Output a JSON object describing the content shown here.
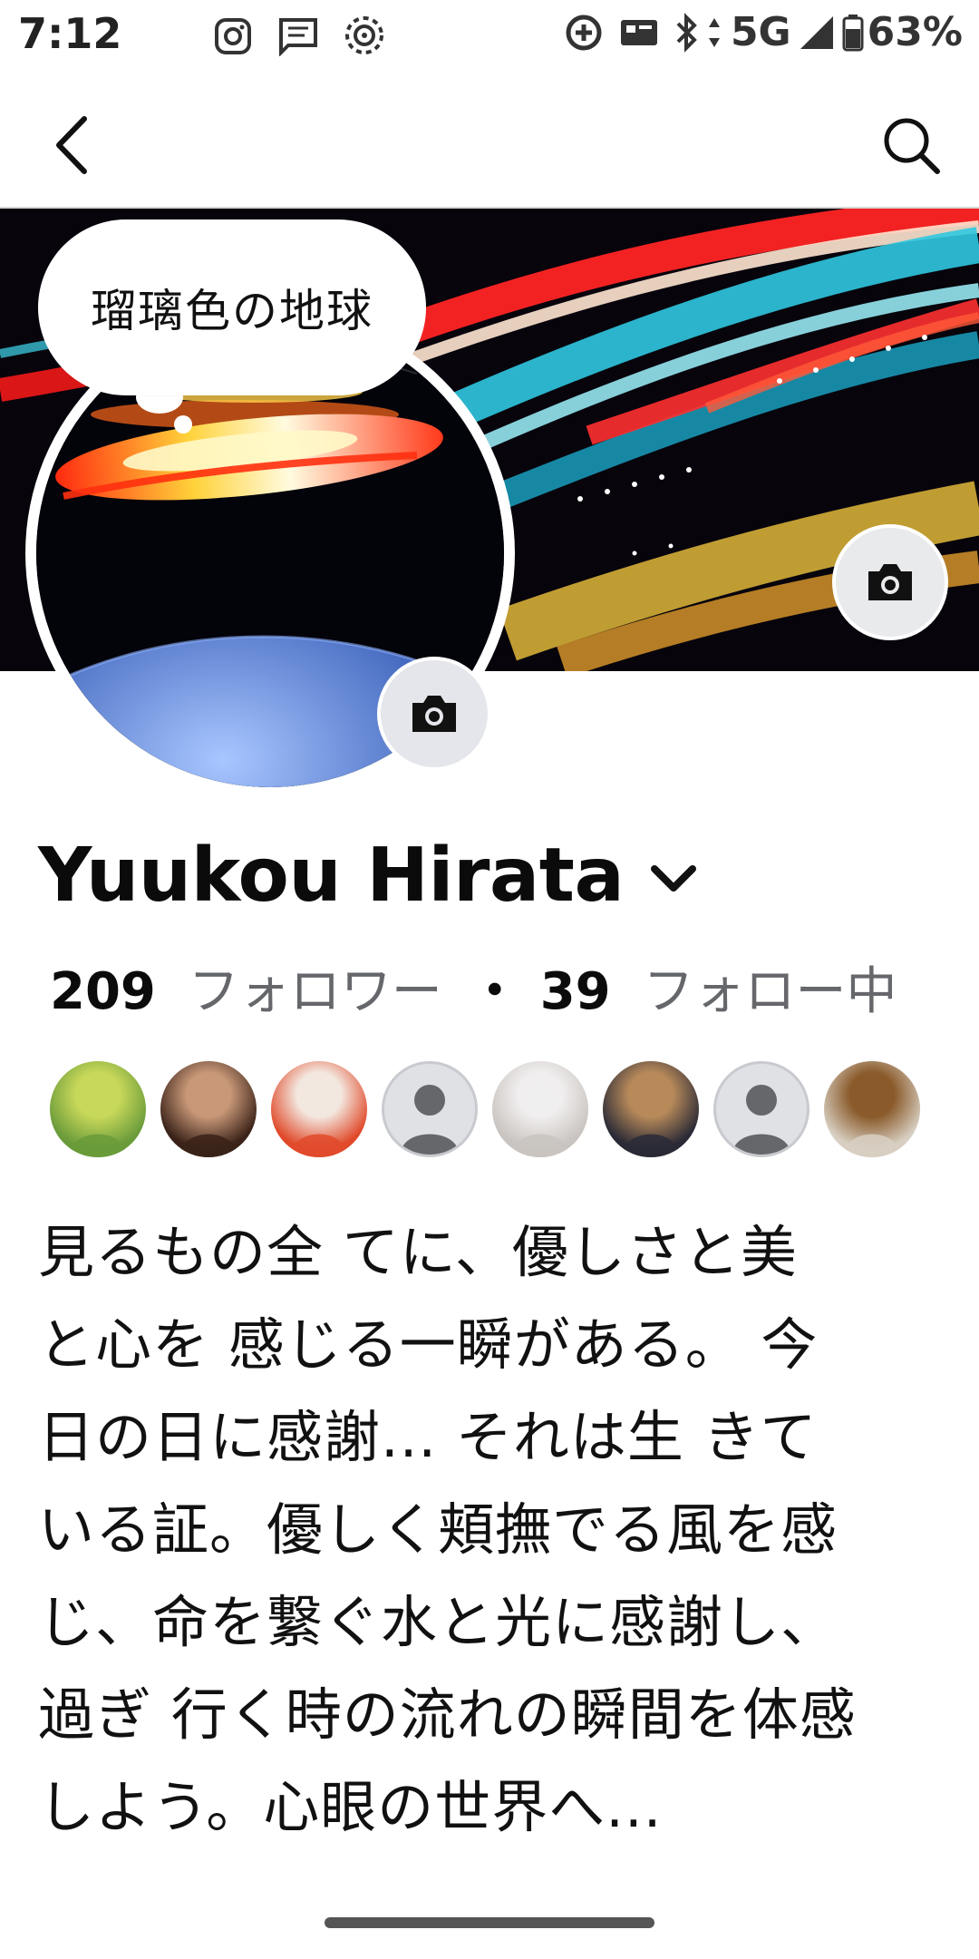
{
  "status_bar": {
    "time": "7:12",
    "network": "5G",
    "battery": "63%",
    "left_icons": [
      "instagram-icon",
      "message-icon",
      "hotspot-icon"
    ],
    "right_icons": [
      "data-saver-icon",
      "cast-icon",
      "bluetooth-icon",
      "signal-icon",
      "battery-icon"
    ]
  },
  "app_bar": {
    "icons": [
      "back-arrow-icon",
      "search-icon"
    ]
  },
  "status_bubble": {
    "text": "瑠璃色の地球"
  },
  "profile": {
    "name": "Yuukou Hirata",
    "followers_count": "209",
    "followers_label": "フォロワー",
    "separator": "・",
    "following_count": "39",
    "following_label": "フォロー中"
  },
  "friends": [
    {
      "kind": "photo",
      "colors": [
        "#6a9b3a",
        "#c8d85a"
      ]
    },
    {
      "kind": "photo",
      "colors": [
        "#3a2218",
        "#c89878"
      ]
    },
    {
      "kind": "photo",
      "colors": [
        "#e04a2a",
        "#f3e8e0"
      ]
    },
    {
      "kind": "placeholder"
    },
    {
      "kind": "photo",
      "colors": [
        "#c9c4c0",
        "#f0eeee"
      ]
    },
    {
      "kind": "photo",
      "colors": [
        "#2a2a36",
        "#b88a5a"
      ]
    },
    {
      "kind": "placeholder"
    },
    {
      "kind": "photo",
      "colors": [
        "#d8cfc2",
        "#8a5a2a"
      ]
    }
  ],
  "bio": "見るもの全 てに、優しさと美\nと心を 感じる一瞬がある。 今\n日の日に感謝... それは生 きて\nいる証。優しく頬撫でる風を感\nじ、命を繋ぐ水と光に感謝し、\n過ぎ 行く時の流れの瞬間を体感\nしよう。心眼の世界へ...",
  "colors": {
    "text_secondary": "#65676b",
    "camera_button_bg": "#e4e6eb"
  }
}
